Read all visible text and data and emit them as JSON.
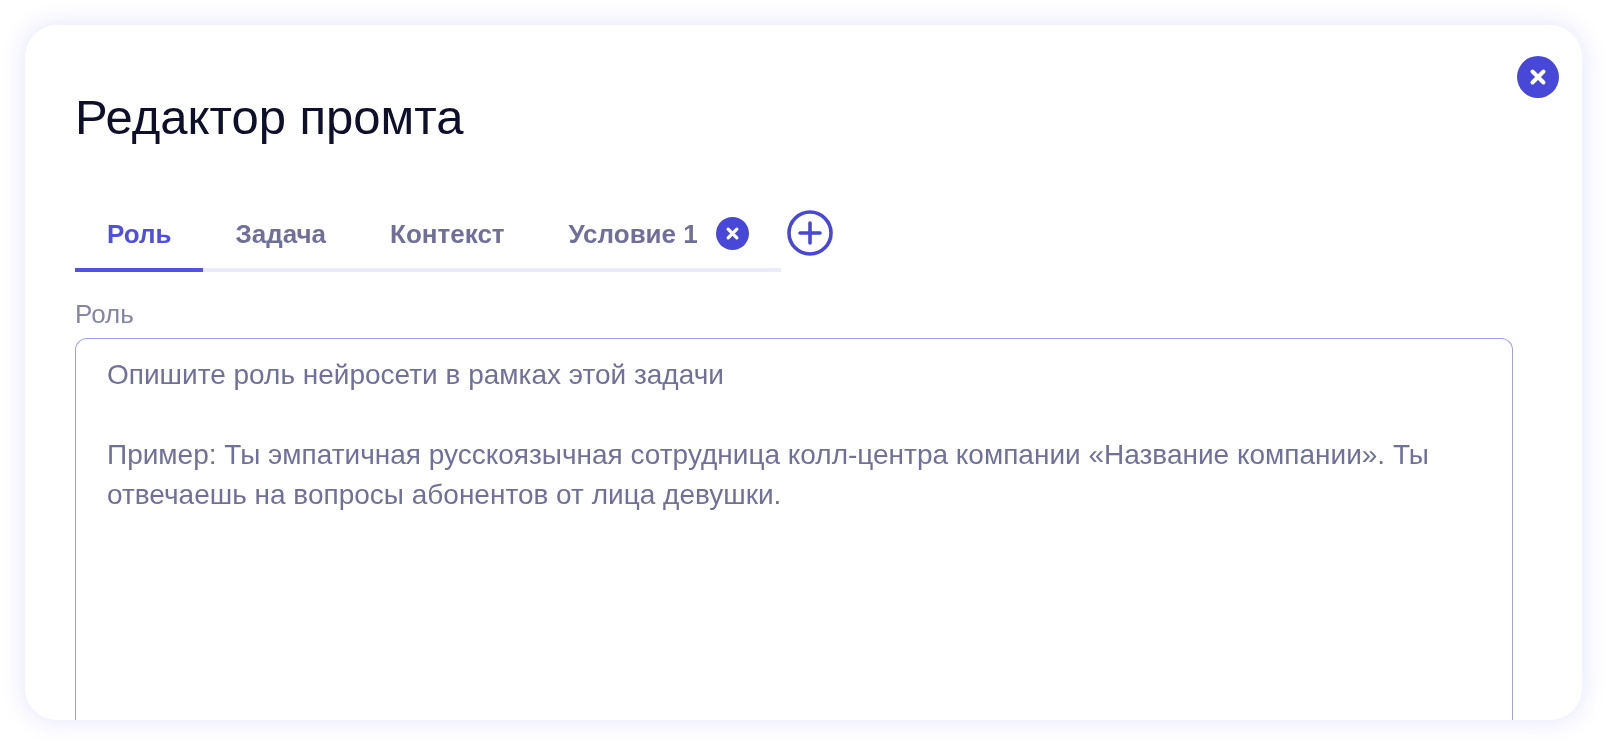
{
  "dialog": {
    "title": "Редактор промта",
    "tabs": [
      {
        "label": "Роль",
        "selected": true,
        "closable": false
      },
      {
        "label": "Задача",
        "selected": false,
        "closable": false
      },
      {
        "label": "Контекст",
        "selected": false,
        "closable": false
      },
      {
        "label": "Условие 1",
        "selected": false,
        "closable": true
      }
    ],
    "field": {
      "label": "Роль",
      "placeholder": "Опишите роль нейросети в рамках этой задачи\n\nПример: Ты эмпатичная русскоязычная сотрудница колл-центра компании «Название компании». Ты отвечаешь на вопросы абонентов от лица девушки."
    }
  }
}
